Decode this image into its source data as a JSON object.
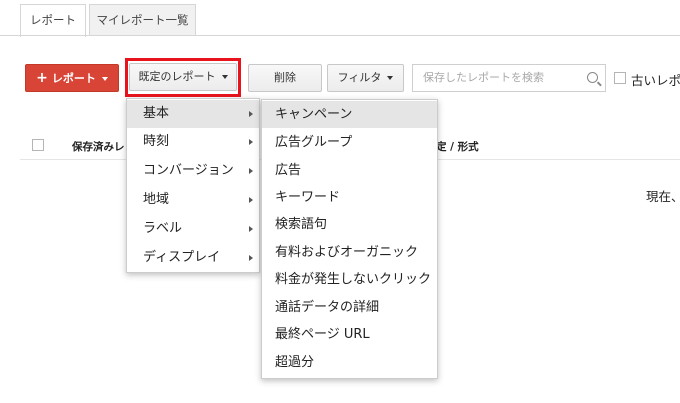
{
  "tabs": [
    {
      "label": "レポート",
      "active": true
    },
    {
      "label": "マイレポート一覧",
      "active": false
    }
  ],
  "toolbar": {
    "report_button": "レポート",
    "predefined_button": "既定のレポート",
    "delete_button": "削除",
    "filter_button": "フィルタ",
    "search_placeholder": "保存したレポートを検索",
    "old_reports_label": "古いレポ"
  },
  "table": {
    "col_saved": "保存済みレ",
    "col_format": "定 / 形式"
  },
  "status_text": "現在、",
  "menu_categories": [
    {
      "label": "基本",
      "selected": true
    },
    {
      "label": "時刻",
      "selected": false
    },
    {
      "label": "コンバージョン",
      "selected": false
    },
    {
      "label": "地域",
      "selected": false
    },
    {
      "label": "ラベル",
      "selected": false
    },
    {
      "label": "ディスプレイ",
      "selected": false
    }
  ],
  "submenu_items": [
    {
      "label": "キャンペーン",
      "selected": true
    },
    {
      "label": "広告グループ",
      "selected": false
    },
    {
      "label": "広告",
      "selected": false
    },
    {
      "label": "キーワード",
      "selected": false
    },
    {
      "label": "検索語句",
      "selected": false
    },
    {
      "label": "有料およびオーガニック",
      "selected": false
    },
    {
      "label": "料金が発生しないクリック",
      "selected": false
    },
    {
      "label": "通話データの詳細",
      "selected": false
    },
    {
      "label": "最終ページ URL",
      "selected": false
    },
    {
      "label": "超過分",
      "selected": false
    }
  ],
  "colors": {
    "accent_red": "#d84436",
    "highlight_border": "#e8131d"
  }
}
